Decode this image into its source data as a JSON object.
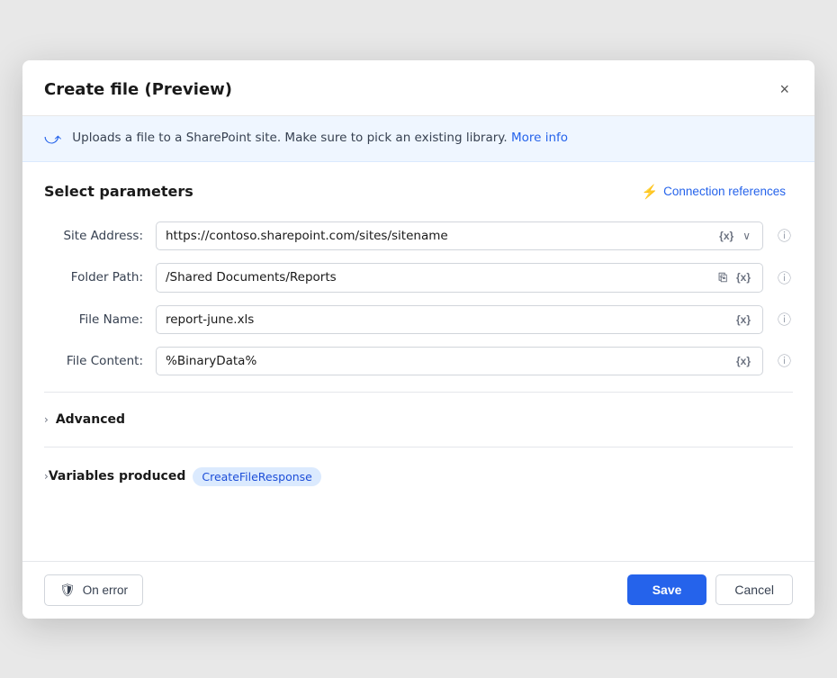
{
  "dialog": {
    "title": "Create file (Preview)",
    "close_label": "×"
  },
  "banner": {
    "text": "Uploads a file to a SharePoint site. Make sure to pick an existing library.",
    "link_text": "More info"
  },
  "section": {
    "title": "Select parameters",
    "connection_refs_label": "Connection references"
  },
  "fields": [
    {
      "label": "Site Address:",
      "value": "https://contoso.sharepoint.com/sites/sitename",
      "token": "{x}",
      "has_chevron": true,
      "has_file_icon": false,
      "name": "site-address"
    },
    {
      "label": "Folder Path:",
      "value": "/Shared Documents/Reports",
      "token": "{x}",
      "has_chevron": false,
      "has_file_icon": true,
      "name": "folder-path"
    },
    {
      "label": "File Name:",
      "value": "report-june.xls",
      "token": "{x}",
      "has_chevron": false,
      "has_file_icon": false,
      "name": "file-name"
    },
    {
      "label": "File Content:",
      "value": "%BinaryData%",
      "token": "{x}",
      "has_chevron": false,
      "has_file_icon": false,
      "name": "file-content"
    }
  ],
  "advanced": {
    "label": "Advanced"
  },
  "variables": {
    "label": "Variables produced",
    "badge": "CreateFileResponse"
  },
  "footer": {
    "on_error_label": "On error",
    "save_label": "Save",
    "cancel_label": "Cancel"
  },
  "icons": {
    "close": "✕",
    "plug": "🔌",
    "info": "ⓘ",
    "chevron_down": "∨",
    "chevron_right": "›",
    "file": "⎘",
    "shield": "🛡"
  }
}
